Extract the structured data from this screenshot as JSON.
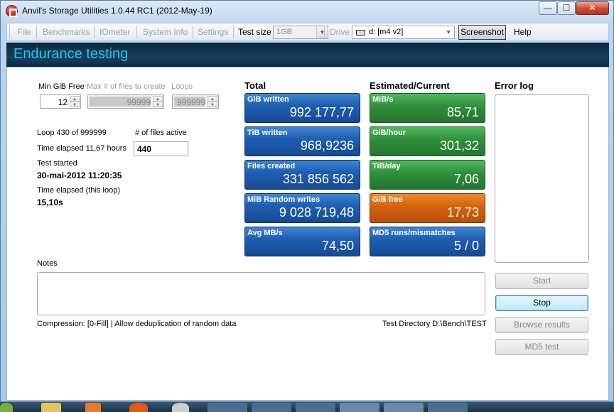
{
  "window": {
    "title": "Anvil's Storage Utilities 1.0.44 RC1 (2012-May-19)",
    "minimize_glyph": "—",
    "maximize_glyph": "☐",
    "close_glyph": "✕"
  },
  "menu": {
    "file": "File",
    "benchmarks": "Benchmarks",
    "iometer": "IOmeter",
    "system_info": "System Info",
    "settings": "Settings",
    "test_size_label": "Test size",
    "test_size_value": "1GB",
    "drive_label": "Drive",
    "drive_value": "d: [m4 v2]",
    "screenshot": "Screenshot",
    "help": "Help"
  },
  "header": {
    "title": "Endurance testing"
  },
  "settings_panel": {
    "min_gib_free_label": "Min GiB Free",
    "min_gib_free_value": "12",
    "max_files_label": "Max # of files to create",
    "max_files_value": "99999",
    "loops_label": "Loops",
    "loops_value": "999999"
  },
  "status": {
    "loop_text": "Loop 430 of 999999",
    "files_active_label": "# of files active",
    "files_active_value": "440",
    "time_elapsed_text": "Time elapsed 11,67 hours",
    "test_started_label": "Test started",
    "test_started_value": "30-mai-2012 11:20:35",
    "time_elapsed_loop_label": "Time elapsed (this loop)",
    "time_elapsed_loop_value": "15,10s"
  },
  "totals": {
    "heading": "Total",
    "tiles": [
      {
        "label": "GiB written",
        "value": "992 177,77"
      },
      {
        "label": "TiB written",
        "value": "968,9236"
      },
      {
        "label": "Files created",
        "value": "331 856 562"
      },
      {
        "label": "MiB Random writes",
        "value": "9 028 719,48"
      },
      {
        "label": "Avg MB/s",
        "value": "74,50"
      }
    ]
  },
  "estimates": {
    "heading": "Estimated/Current",
    "tiles": [
      {
        "label": "MiB/s",
        "value": "85,71",
        "color": "#2f8f3b"
      },
      {
        "label": "GiB/hour",
        "value": "301,32",
        "color": "#2f8f3b"
      },
      {
        "label": "TiB/day",
        "value": "7,06",
        "color": "#2f8f3b"
      },
      {
        "label": "GiB free",
        "value": "17,73",
        "color": "#d4620c"
      },
      {
        "label": "MD5 runs/mismatches",
        "value": "5 / 0",
        "color": "#1f5fb3"
      }
    ]
  },
  "error_log": {
    "label": "Error log"
  },
  "notes": {
    "label": "Notes"
  },
  "footer": {
    "compression": "Compression: [0-Fill] | Allow deduplication of random data",
    "test_directory": "Test Directory D:\\Bench\\TEST"
  },
  "buttons": {
    "start": "Start",
    "stop": "Stop",
    "browse_results": "Browse results",
    "md5_test": "MD5 test"
  }
}
